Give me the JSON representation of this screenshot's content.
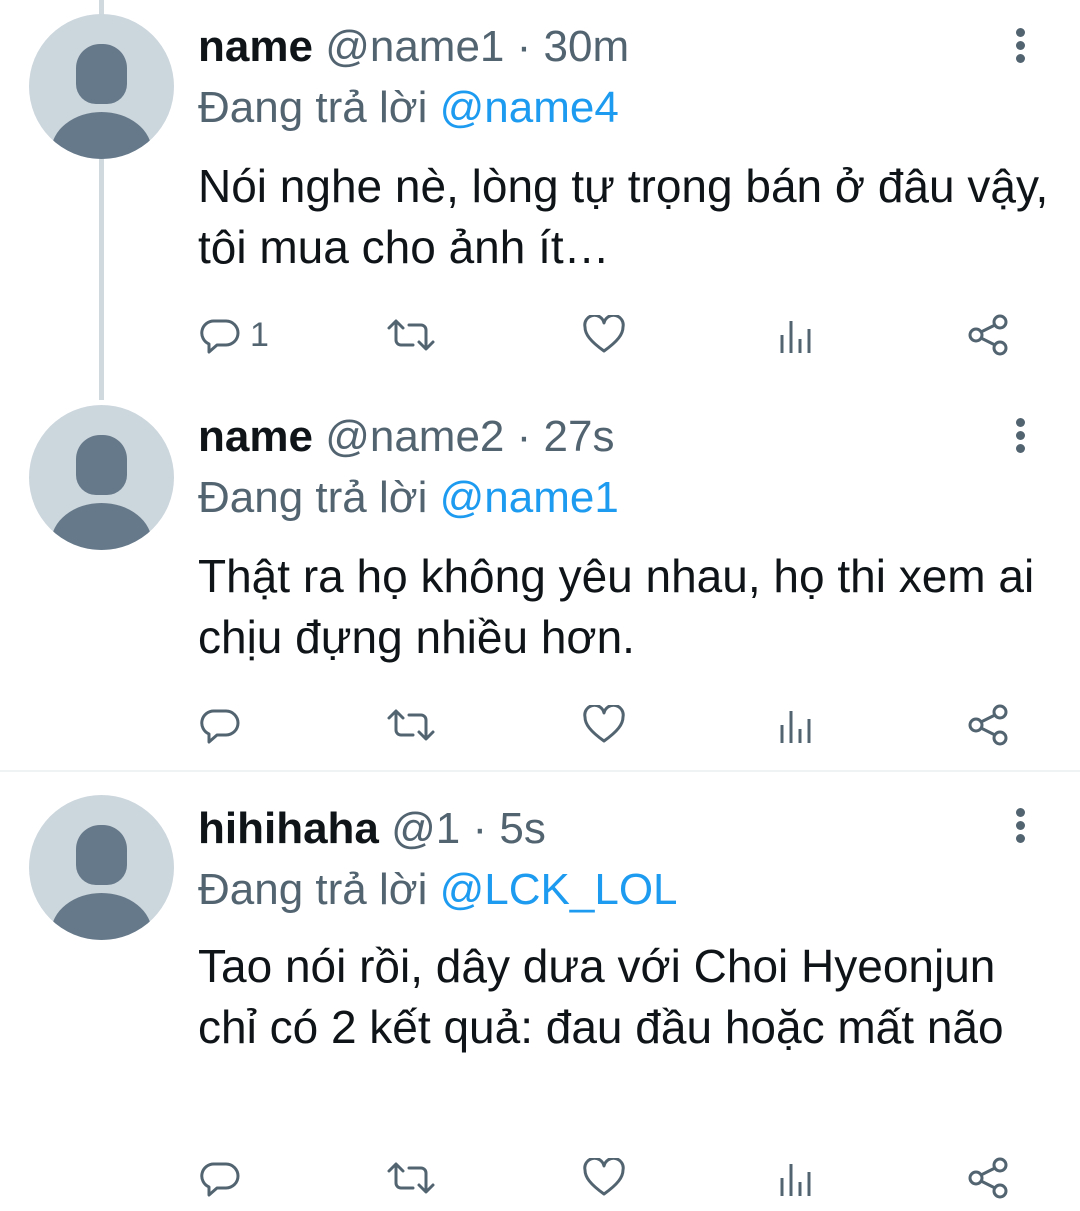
{
  "tweets": [
    {
      "name": "name",
      "handle": "@name1",
      "separator": "·",
      "time": "30m",
      "reply_prefix": "Đang trả lời",
      "reply_to": "@name4",
      "text": "Nói nghe nè, lòng tự trọng bán ở đâu vậy, tôi mua cho ảnh ít…",
      "reply_count": "1"
    },
    {
      "name": "name",
      "handle": "@name2",
      "separator": "·",
      "time": "27s",
      "reply_prefix": "Đang trả lời",
      "reply_to": "@name1",
      "text": "Thật ra họ không yêu nhau, họ thi xem ai chịu đựng nhiều hơn.",
      "reply_count": ""
    },
    {
      "name": "hihihaha",
      "handle": "@1",
      "separator": "·",
      "time": "5s",
      "reply_prefix": "Đang trả lời",
      "reply_to": "@LCK_LOL",
      "text": "Tao nói rồi, dây dưa với Choi Hyeonjun chỉ có 2 kết quả: đau đầu hoặc mất não",
      "reply_count": ""
    }
  ],
  "icons": {
    "reply": "reply-icon",
    "retweet": "retweet-icon",
    "like": "like-icon",
    "views": "views-icon",
    "share": "share-icon",
    "more": "more-vertical-icon"
  },
  "colors": {
    "secondary_text": "#536471",
    "mention": "#1d9bf0",
    "avatar_bg": "#ccd6dd",
    "avatar_fg": "#66798a",
    "thread_line": "#cfd9de"
  }
}
